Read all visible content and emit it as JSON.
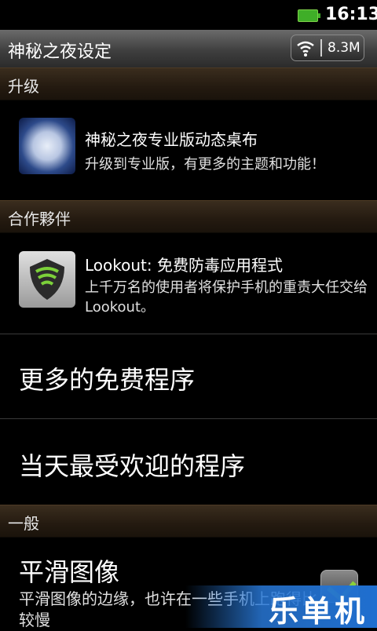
{
  "status_bar": {
    "time": "16:13"
  },
  "title_bar": {
    "title": "神秘之夜设定",
    "network_speed": "8.3M"
  },
  "sections": {
    "upgrade": "升级",
    "partners": "合作夥伴",
    "general": "一般"
  },
  "upgrade_item": {
    "title": "神秘之夜专业版动态桌布",
    "subtitle": "升级到专业版，有更多的主题和功能！"
  },
  "partner_item": {
    "title": "Lookout: 免费防毒应用程式",
    "subtitle": "上千万名的使用者将保护手机的重责大任交给Lookout。"
  },
  "more_free_apps": "更多的免费程序",
  "popular_today": "当天最受欢迎的程序",
  "smooth_image": {
    "title": "平滑图像",
    "subtitle": "平滑图像的边缘，也许在一些手机上跑得比较慢"
  },
  "watermark": "乐单机",
  "colors": {
    "section_bg": "#2a1f14",
    "title_bar": "#4a4a4a",
    "accent_green": "#8ad13a",
    "watermark_blue": "#1f6fd0"
  }
}
